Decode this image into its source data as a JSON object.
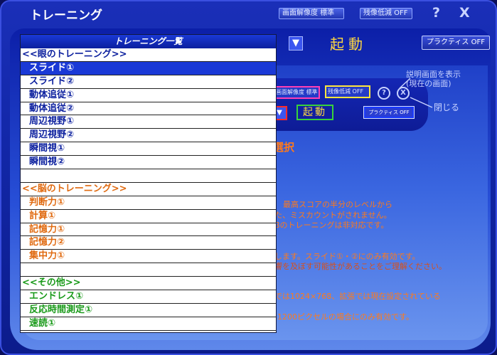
{
  "window": {
    "title": "トレーニング",
    "resolution_chip": "画面解像度 標準",
    "ghost_chip": "残像低減 OFF",
    "help_glyph": "?",
    "close_glyph": "X"
  },
  "toolbar": {
    "arrow_glyph": "▼",
    "start_label": "起動",
    "practice_label": "プラクティス OFF"
  },
  "preview": {
    "resolution_chip": "画面解像度 標準",
    "ghost_chip": "残像低減 OFF",
    "help_glyph": "?",
    "close_glyph": "X",
    "arrow_glyph": "▼",
    "start_label": "起動",
    "practice_label": "プラクティス OFF",
    "callout_help_line1": "説明画面を表示",
    "callout_help_line2": "(現在の画面)",
    "callout_close": "閉じる"
  },
  "content": {
    "selection_heading": "選択",
    "lines": [
      "最高スコアの半分のレベルから",
      "た、ミスカウントがされません。",
      "Bのトレーニングは非対応です。",
      "します。スライド①・②にのみ有効です。",
      "響を及ぼす可能性があることをご理解ください。",
      "では1024×768、拡張では現在設定されている",
      "-1200ピクセルの場合にのみ有効です。"
    ]
  },
  "dropdown": {
    "header": "トレーニング一覧",
    "items": [
      {
        "label": "<<眼のトレーニング>>",
        "kind": "category",
        "group": "eye"
      },
      {
        "label": "スライド①",
        "kind": "item",
        "group": "eye",
        "selected": true
      },
      {
        "label": "スライド②",
        "kind": "item",
        "group": "eye"
      },
      {
        "label": "動体追従①",
        "kind": "item",
        "group": "eye"
      },
      {
        "label": "動体追従②",
        "kind": "item",
        "group": "eye"
      },
      {
        "label": "周辺視野①",
        "kind": "item",
        "group": "eye"
      },
      {
        "label": "周辺視野②",
        "kind": "item",
        "group": "eye"
      },
      {
        "label": "瞬間視①",
        "kind": "item",
        "group": "eye"
      },
      {
        "label": "瞬間視②",
        "kind": "item",
        "group": "eye"
      },
      {
        "label": "",
        "kind": "blank",
        "group": "eye"
      },
      {
        "label": "<<脳のトレーニング>>",
        "kind": "category",
        "group": "brain"
      },
      {
        "label": "判断力①",
        "kind": "item",
        "group": "brain"
      },
      {
        "label": "計算①",
        "kind": "item",
        "group": "brain"
      },
      {
        "label": "記憶力①",
        "kind": "item",
        "group": "brain"
      },
      {
        "label": "記憶力②",
        "kind": "item",
        "group": "brain"
      },
      {
        "label": "集中力①",
        "kind": "item",
        "group": "brain"
      },
      {
        "label": "",
        "kind": "blank",
        "group": "brain"
      },
      {
        "label": "<<その他>>",
        "kind": "category",
        "group": "other"
      },
      {
        "label": "エンドレス①",
        "kind": "item",
        "group": "other"
      },
      {
        "label": "反応時間測定①",
        "kind": "item",
        "group": "other"
      },
      {
        "label": "速読①",
        "kind": "item",
        "group": "other"
      }
    ]
  }
}
